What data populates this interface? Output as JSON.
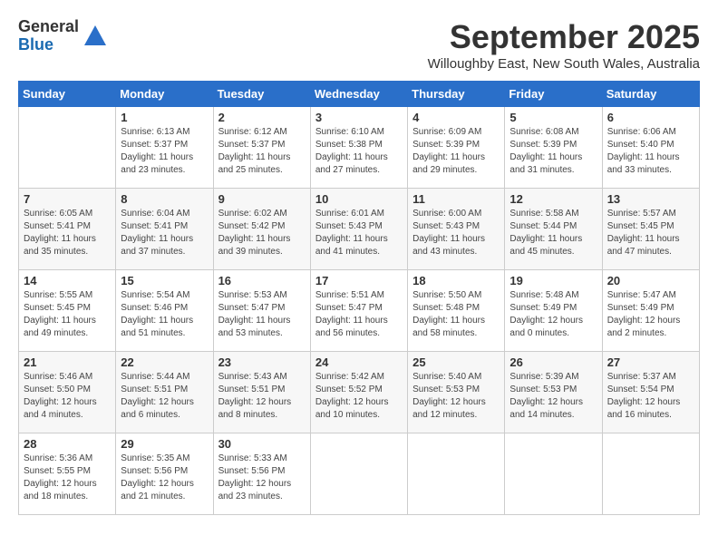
{
  "header": {
    "logo": {
      "general": "General",
      "blue": "Blue"
    },
    "month": "September 2025",
    "location": "Willoughby East, New South Wales, Australia"
  },
  "weekdays": [
    "Sunday",
    "Monday",
    "Tuesday",
    "Wednesday",
    "Thursday",
    "Friday",
    "Saturday"
  ],
  "weeks": [
    [
      {
        "day": "",
        "info": ""
      },
      {
        "day": "1",
        "info": "Sunrise: 6:13 AM\nSunset: 5:37 PM\nDaylight: 11 hours\nand 23 minutes."
      },
      {
        "day": "2",
        "info": "Sunrise: 6:12 AM\nSunset: 5:37 PM\nDaylight: 11 hours\nand 25 minutes."
      },
      {
        "day": "3",
        "info": "Sunrise: 6:10 AM\nSunset: 5:38 PM\nDaylight: 11 hours\nand 27 minutes."
      },
      {
        "day": "4",
        "info": "Sunrise: 6:09 AM\nSunset: 5:39 PM\nDaylight: 11 hours\nand 29 minutes."
      },
      {
        "day": "5",
        "info": "Sunrise: 6:08 AM\nSunset: 5:39 PM\nDaylight: 11 hours\nand 31 minutes."
      },
      {
        "day": "6",
        "info": "Sunrise: 6:06 AM\nSunset: 5:40 PM\nDaylight: 11 hours\nand 33 minutes."
      }
    ],
    [
      {
        "day": "7",
        "info": "Sunrise: 6:05 AM\nSunset: 5:41 PM\nDaylight: 11 hours\nand 35 minutes."
      },
      {
        "day": "8",
        "info": "Sunrise: 6:04 AM\nSunset: 5:41 PM\nDaylight: 11 hours\nand 37 minutes."
      },
      {
        "day": "9",
        "info": "Sunrise: 6:02 AM\nSunset: 5:42 PM\nDaylight: 11 hours\nand 39 minutes."
      },
      {
        "day": "10",
        "info": "Sunrise: 6:01 AM\nSunset: 5:43 PM\nDaylight: 11 hours\nand 41 minutes."
      },
      {
        "day": "11",
        "info": "Sunrise: 6:00 AM\nSunset: 5:43 PM\nDaylight: 11 hours\nand 43 minutes."
      },
      {
        "day": "12",
        "info": "Sunrise: 5:58 AM\nSunset: 5:44 PM\nDaylight: 11 hours\nand 45 minutes."
      },
      {
        "day": "13",
        "info": "Sunrise: 5:57 AM\nSunset: 5:45 PM\nDaylight: 11 hours\nand 47 minutes."
      }
    ],
    [
      {
        "day": "14",
        "info": "Sunrise: 5:55 AM\nSunset: 5:45 PM\nDaylight: 11 hours\nand 49 minutes."
      },
      {
        "day": "15",
        "info": "Sunrise: 5:54 AM\nSunset: 5:46 PM\nDaylight: 11 hours\nand 51 minutes."
      },
      {
        "day": "16",
        "info": "Sunrise: 5:53 AM\nSunset: 5:47 PM\nDaylight: 11 hours\nand 53 minutes."
      },
      {
        "day": "17",
        "info": "Sunrise: 5:51 AM\nSunset: 5:47 PM\nDaylight: 11 hours\nand 56 minutes."
      },
      {
        "day": "18",
        "info": "Sunrise: 5:50 AM\nSunset: 5:48 PM\nDaylight: 11 hours\nand 58 minutes."
      },
      {
        "day": "19",
        "info": "Sunrise: 5:48 AM\nSunset: 5:49 PM\nDaylight: 12 hours\nand 0 minutes."
      },
      {
        "day": "20",
        "info": "Sunrise: 5:47 AM\nSunset: 5:49 PM\nDaylight: 12 hours\nand 2 minutes."
      }
    ],
    [
      {
        "day": "21",
        "info": "Sunrise: 5:46 AM\nSunset: 5:50 PM\nDaylight: 12 hours\nand 4 minutes."
      },
      {
        "day": "22",
        "info": "Sunrise: 5:44 AM\nSunset: 5:51 PM\nDaylight: 12 hours\nand 6 minutes."
      },
      {
        "day": "23",
        "info": "Sunrise: 5:43 AM\nSunset: 5:51 PM\nDaylight: 12 hours\nand 8 minutes."
      },
      {
        "day": "24",
        "info": "Sunrise: 5:42 AM\nSunset: 5:52 PM\nDaylight: 12 hours\nand 10 minutes."
      },
      {
        "day": "25",
        "info": "Sunrise: 5:40 AM\nSunset: 5:53 PM\nDaylight: 12 hours\nand 12 minutes."
      },
      {
        "day": "26",
        "info": "Sunrise: 5:39 AM\nSunset: 5:53 PM\nDaylight: 12 hours\nand 14 minutes."
      },
      {
        "day": "27",
        "info": "Sunrise: 5:37 AM\nSunset: 5:54 PM\nDaylight: 12 hours\nand 16 minutes."
      }
    ],
    [
      {
        "day": "28",
        "info": "Sunrise: 5:36 AM\nSunset: 5:55 PM\nDaylight: 12 hours\nand 18 minutes."
      },
      {
        "day": "29",
        "info": "Sunrise: 5:35 AM\nSunset: 5:56 PM\nDaylight: 12 hours\nand 21 minutes."
      },
      {
        "day": "30",
        "info": "Sunrise: 5:33 AM\nSunset: 5:56 PM\nDaylight: 12 hours\nand 23 minutes."
      },
      {
        "day": "",
        "info": ""
      },
      {
        "day": "",
        "info": ""
      },
      {
        "day": "",
        "info": ""
      },
      {
        "day": "",
        "info": ""
      }
    ]
  ]
}
